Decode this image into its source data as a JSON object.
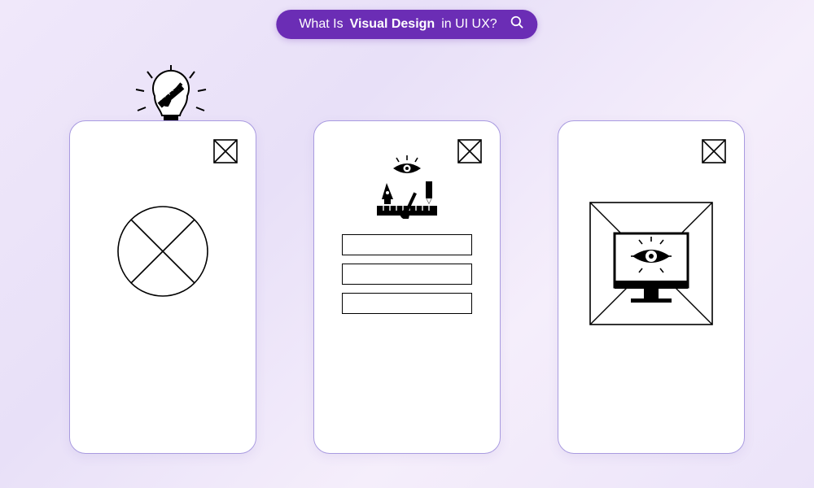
{
  "search": {
    "prefix": "What Is ",
    "bold": "Visual Design",
    "suffix": " in UI UX?"
  }
}
